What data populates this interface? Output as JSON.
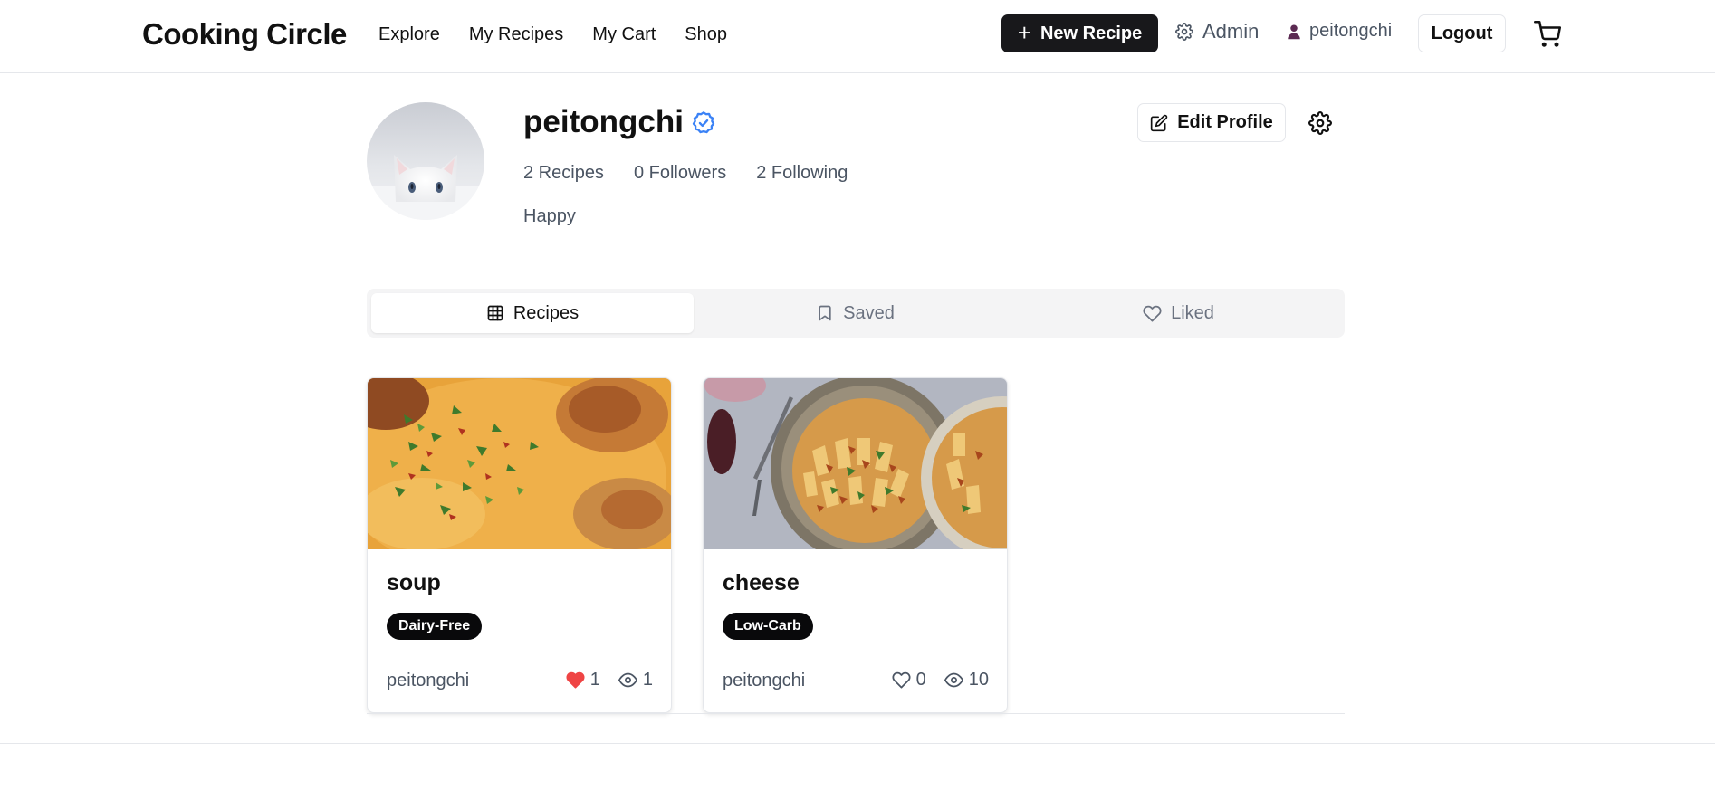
{
  "header": {
    "brand": "Cooking Circle",
    "nav": [
      "Explore",
      "My Recipes",
      "My Cart",
      "Shop"
    ],
    "new_recipe_label": "New Recipe",
    "admin_label": "Admin",
    "username": "peitongchi",
    "logout_label": "Logout",
    "icons": {
      "admin": "gear-icon",
      "user": "user-icon",
      "cart": "shopping-cart-icon",
      "new": "plus-icon"
    }
  },
  "profile": {
    "name": "peitongchi",
    "verified_icon": "verified-badge-icon",
    "stats": {
      "recipes": "2 Recipes",
      "followers": "0 Followers",
      "following": "2 Following"
    },
    "bio": "Happy",
    "edit_profile_label": "Edit Profile",
    "avatar": "white-cat-avatar"
  },
  "tabs": [
    {
      "label": "Recipes",
      "icon": "grid-icon",
      "active": true
    },
    {
      "label": "Saved",
      "icon": "bookmark-icon",
      "active": false
    },
    {
      "label": "Liked",
      "icon": "heart-icon",
      "active": false
    }
  ],
  "recipes": [
    {
      "title": "soup",
      "tag": "Dairy-Free",
      "author": "peitongchi",
      "likes": "1",
      "liked": true,
      "views": "1",
      "image": "creamy-chicken-dish"
    },
    {
      "title": "cheese",
      "tag": "Low-Carb",
      "author": "peitongchi",
      "likes": "0",
      "liked": false,
      "views": "10",
      "image": "rigatoni-pasta-bowl"
    }
  ],
  "colors": {
    "primary": "#18181b",
    "like_red": "#ef4444",
    "verified_blue": "#3b82f6",
    "muted_text": "#4b5563"
  }
}
